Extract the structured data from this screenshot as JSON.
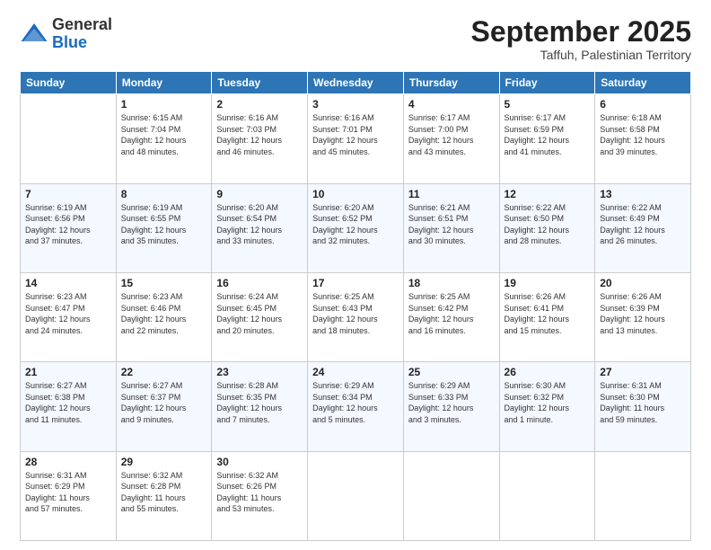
{
  "logo": {
    "general": "General",
    "blue": "Blue"
  },
  "title": "September 2025",
  "subtitle": "Taffuh, Palestinian Territory",
  "days": [
    "Sunday",
    "Monday",
    "Tuesday",
    "Wednesday",
    "Thursday",
    "Friday",
    "Saturday"
  ],
  "weeks": [
    [
      {
        "day": "",
        "info": ""
      },
      {
        "day": "1",
        "info": "Sunrise: 6:15 AM\nSunset: 7:04 PM\nDaylight: 12 hours\nand 48 minutes."
      },
      {
        "day": "2",
        "info": "Sunrise: 6:16 AM\nSunset: 7:03 PM\nDaylight: 12 hours\nand 46 minutes."
      },
      {
        "day": "3",
        "info": "Sunrise: 6:16 AM\nSunset: 7:01 PM\nDaylight: 12 hours\nand 45 minutes."
      },
      {
        "day": "4",
        "info": "Sunrise: 6:17 AM\nSunset: 7:00 PM\nDaylight: 12 hours\nand 43 minutes."
      },
      {
        "day": "5",
        "info": "Sunrise: 6:17 AM\nSunset: 6:59 PM\nDaylight: 12 hours\nand 41 minutes."
      },
      {
        "day": "6",
        "info": "Sunrise: 6:18 AM\nSunset: 6:58 PM\nDaylight: 12 hours\nand 39 minutes."
      }
    ],
    [
      {
        "day": "7",
        "info": "Sunrise: 6:19 AM\nSunset: 6:56 PM\nDaylight: 12 hours\nand 37 minutes."
      },
      {
        "day": "8",
        "info": "Sunrise: 6:19 AM\nSunset: 6:55 PM\nDaylight: 12 hours\nand 35 minutes."
      },
      {
        "day": "9",
        "info": "Sunrise: 6:20 AM\nSunset: 6:54 PM\nDaylight: 12 hours\nand 33 minutes."
      },
      {
        "day": "10",
        "info": "Sunrise: 6:20 AM\nSunset: 6:52 PM\nDaylight: 12 hours\nand 32 minutes."
      },
      {
        "day": "11",
        "info": "Sunrise: 6:21 AM\nSunset: 6:51 PM\nDaylight: 12 hours\nand 30 minutes."
      },
      {
        "day": "12",
        "info": "Sunrise: 6:22 AM\nSunset: 6:50 PM\nDaylight: 12 hours\nand 28 minutes."
      },
      {
        "day": "13",
        "info": "Sunrise: 6:22 AM\nSunset: 6:49 PM\nDaylight: 12 hours\nand 26 minutes."
      }
    ],
    [
      {
        "day": "14",
        "info": "Sunrise: 6:23 AM\nSunset: 6:47 PM\nDaylight: 12 hours\nand 24 minutes."
      },
      {
        "day": "15",
        "info": "Sunrise: 6:23 AM\nSunset: 6:46 PM\nDaylight: 12 hours\nand 22 minutes."
      },
      {
        "day": "16",
        "info": "Sunrise: 6:24 AM\nSunset: 6:45 PM\nDaylight: 12 hours\nand 20 minutes."
      },
      {
        "day": "17",
        "info": "Sunrise: 6:25 AM\nSunset: 6:43 PM\nDaylight: 12 hours\nand 18 minutes."
      },
      {
        "day": "18",
        "info": "Sunrise: 6:25 AM\nSunset: 6:42 PM\nDaylight: 12 hours\nand 16 minutes."
      },
      {
        "day": "19",
        "info": "Sunrise: 6:26 AM\nSunset: 6:41 PM\nDaylight: 12 hours\nand 15 minutes."
      },
      {
        "day": "20",
        "info": "Sunrise: 6:26 AM\nSunset: 6:39 PM\nDaylight: 12 hours\nand 13 minutes."
      }
    ],
    [
      {
        "day": "21",
        "info": "Sunrise: 6:27 AM\nSunset: 6:38 PM\nDaylight: 12 hours\nand 11 minutes."
      },
      {
        "day": "22",
        "info": "Sunrise: 6:27 AM\nSunset: 6:37 PM\nDaylight: 12 hours\nand 9 minutes."
      },
      {
        "day": "23",
        "info": "Sunrise: 6:28 AM\nSunset: 6:35 PM\nDaylight: 12 hours\nand 7 minutes."
      },
      {
        "day": "24",
        "info": "Sunrise: 6:29 AM\nSunset: 6:34 PM\nDaylight: 12 hours\nand 5 minutes."
      },
      {
        "day": "25",
        "info": "Sunrise: 6:29 AM\nSunset: 6:33 PM\nDaylight: 12 hours\nand 3 minutes."
      },
      {
        "day": "26",
        "info": "Sunrise: 6:30 AM\nSunset: 6:32 PM\nDaylight: 12 hours\nand 1 minute."
      },
      {
        "day": "27",
        "info": "Sunrise: 6:31 AM\nSunset: 6:30 PM\nDaylight: 11 hours\nand 59 minutes."
      }
    ],
    [
      {
        "day": "28",
        "info": "Sunrise: 6:31 AM\nSunset: 6:29 PM\nDaylight: 11 hours\nand 57 minutes."
      },
      {
        "day": "29",
        "info": "Sunrise: 6:32 AM\nSunset: 6:28 PM\nDaylight: 11 hours\nand 55 minutes."
      },
      {
        "day": "30",
        "info": "Sunrise: 6:32 AM\nSunset: 6:26 PM\nDaylight: 11 hours\nand 53 minutes."
      },
      {
        "day": "",
        "info": ""
      },
      {
        "day": "",
        "info": ""
      },
      {
        "day": "",
        "info": ""
      },
      {
        "day": "",
        "info": ""
      }
    ]
  ]
}
